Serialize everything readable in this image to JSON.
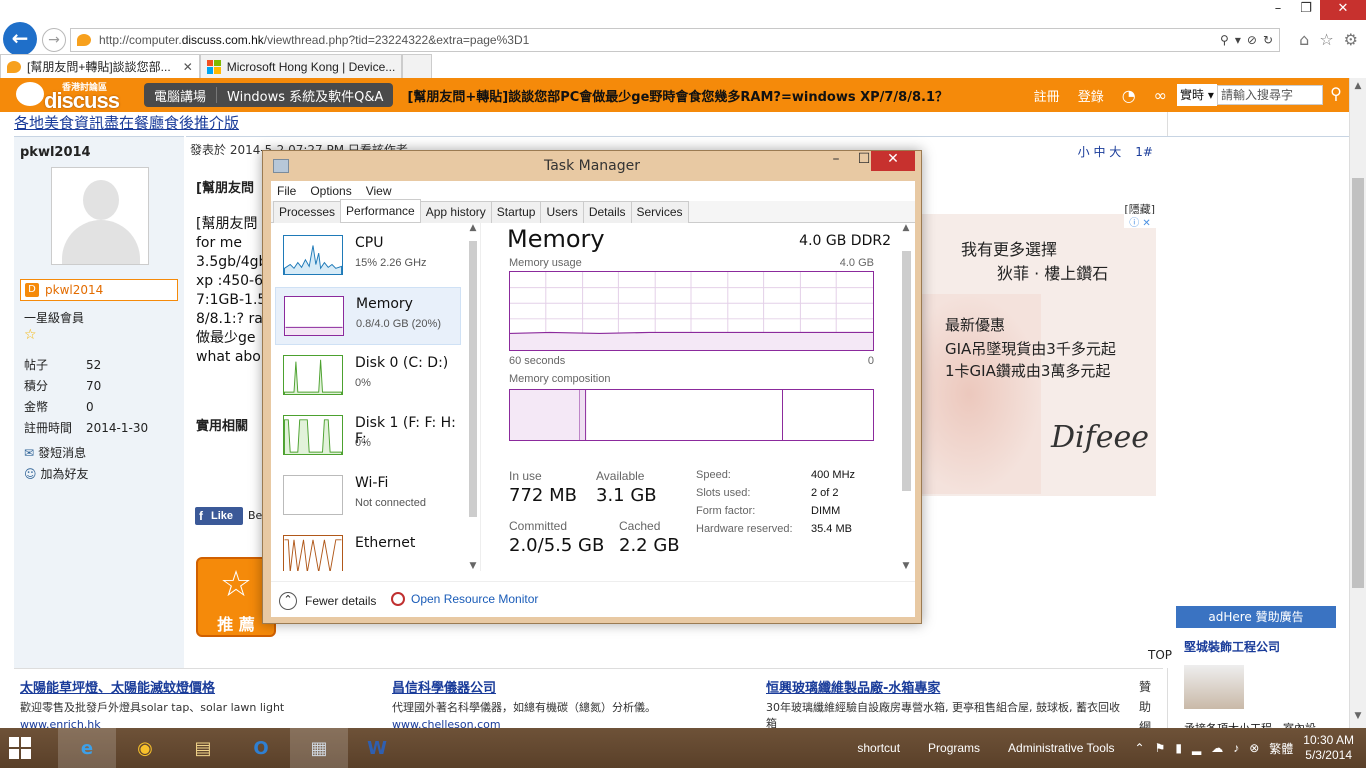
{
  "window": {
    "min": "–",
    "max": "❐",
    "close": "✕"
  },
  "browser": {
    "url_prefix": "http://computer.",
    "url_host": "discuss.com.hk",
    "url_rest": "/viewthread.php?tid=23224322&extra=page%3D1",
    "tabs": [
      {
        "label": "[幫朋友問+轉貼]談談您部...",
        "close": "✕"
      },
      {
        "label": "Microsoft Hong Kong | Device...",
        "close": ""
      }
    ]
  },
  "site": {
    "logo_small": "香港討論區",
    "logo_big": "discuss",
    "nav": [
      "電腦講場",
      "Windows 系統及軟件Q&A"
    ],
    "thread_title": "[幫朋友問+轉貼]談談您部PC會做最少ge野時會食您幾多RAM?=windows XP/7/8/8.1？",
    "register": "註冊",
    "login": "登錄",
    "search_select": "實時 ▾",
    "search_placeholder": "請輸入搜尋字"
  },
  "page": {
    "top_link": "各地美食資訊盡在餐廳食後推介版",
    "user": {
      "name": "pkwl2014",
      "box_name": "pkwl2014",
      "rank": "一星級會員",
      "stats": [
        {
          "k": "帖子",
          "v": "52"
        },
        {
          "k": "積分",
          "v": "70"
        },
        {
          "k": "金幣",
          "v": "0"
        },
        {
          "k": "註冊時間",
          "v": "2014-1-30"
        }
      ],
      "links": [
        "發短消息",
        "加為好友"
      ]
    },
    "post": {
      "header": "發表於 2014-5-2 07:27 PM  只看該作者",
      "font_sizes": "小 中 大",
      "floor": "1#",
      "title": "[幫朋友問",
      "body_lines": [
        "[幫朋友問",
        "for me",
        "3.5gb/4gb",
        "xp :450-6",
        "7:1GB-1.5",
        "8/8.1:? ra",
        "做最少ge",
        "what abo"
      ],
      "section": "實用相關",
      "hide": "[隱藏]",
      "fb_like": "Like",
      "fb_after": "Be",
      "recommend": "推 薦",
      "top": "TOP"
    },
    "ad": {
      "line1": "我有更多選擇",
      "line2": "狄菲 · 樓上鑽石",
      "line3": "最新優惠",
      "line4": "GIA吊墜現貨由3千多元起",
      "line5": "1卡GIA鑽戒由3萬多元起",
      "brand": "Difeee"
    },
    "bottom_ads": [
      {
        "title": "太陽能草坪燈、太陽能滅蚊燈價格",
        "desc": "歡迎零售及批發戶外燈具solar tap、solar lawn light",
        "url": "www.enrich.hk"
      },
      {
        "title": "昌信科學儀器公司",
        "desc": "代理國外著名科學儀器，如總有機碳（總氮）分析儀。",
        "url": "www.chelleson.com"
      },
      {
        "title": "恒興玻璃纖維製品廠-水箱專家",
        "desc": "30年玻璃纖維經驗自設廠房專營水箱, 更亭租售組合屋, 鼓球板, 蓄衣回收箱",
        "url": ""
      }
    ],
    "vertical": "贊助網",
    "right_ad": {
      "header": "adHere 贊助廣告",
      "title": "堅城裝飾工程公司",
      "desc": "承接各項大小工程，室內設"
    }
  },
  "taskmgr": {
    "title": "Task Manager",
    "menu": [
      "File",
      "Options",
      "View"
    ],
    "tabs": [
      "Processes",
      "Performance",
      "App history",
      "Startup",
      "Users",
      "Details",
      "Services"
    ],
    "resources": [
      {
        "name": "CPU",
        "sub": "15%  2.26 GHz"
      },
      {
        "name": "Memory",
        "sub": "0.8/4.0 GB (20%)"
      },
      {
        "name": "Disk 0 (C: D:)",
        "sub": "0%"
      },
      {
        "name": "Disk 1 (F: F: H: F:",
        "sub": "0%"
      },
      {
        "name": "Wi-Fi",
        "sub": "Not connected"
      },
      {
        "name": "Ethernet",
        "sub": ""
      }
    ],
    "memory": {
      "title": "Memory",
      "type": "4.0 GB DDR2",
      "usage_label": "Memory usage",
      "usage_max": "4.0 GB",
      "axis_left": "60 seconds",
      "axis_right": "0",
      "composition_label": "Memory composition",
      "in_use_k": "In use",
      "in_use_v": "772 MB",
      "available_k": "Available",
      "available_v": "3.1 GB",
      "committed_k": "Committed",
      "committed_v": "2.0/5.5 GB",
      "cached_k": "Cached",
      "cached_v": "2.2 GB",
      "specs": [
        {
          "k": "Speed:",
          "v": "400 MHz"
        },
        {
          "k": "Slots used:",
          "v": "2 of 2"
        },
        {
          "k": "Form factor:",
          "v": "DIMM"
        },
        {
          "k": "Hardware reserved:",
          "v": "35.4 MB"
        }
      ]
    },
    "fewer_details": "Fewer details",
    "resource_monitor": "Open Resource Monitor"
  },
  "taskbar": {
    "toolbars": [
      "shortcut",
      "Programs",
      "Administrative Tools"
    ],
    "time": "10:30 AM",
    "date": "5/3/2014",
    "lang": "繁體"
  }
}
